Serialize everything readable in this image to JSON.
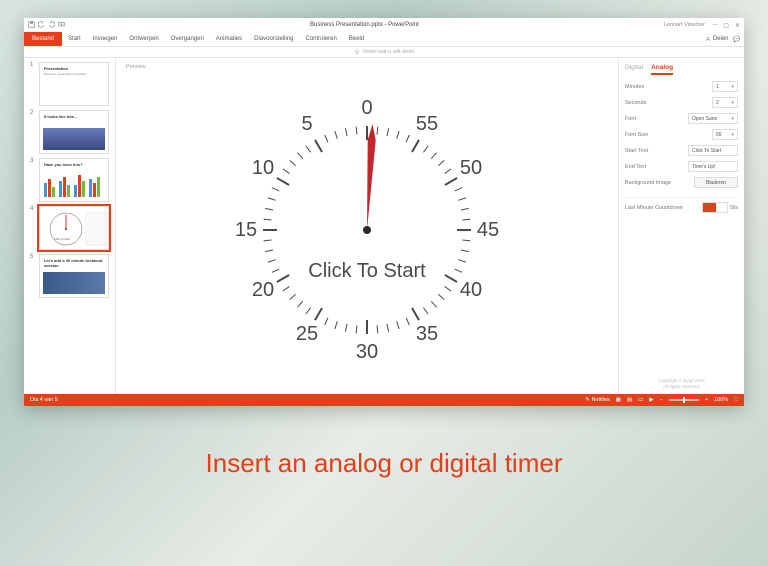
{
  "window": {
    "title": "Business Presentation.pptx - PowerPoint",
    "user": "Lennart Visscher"
  },
  "ribbon": {
    "file": "Bestand",
    "tabs": [
      "Start",
      "Invoegen",
      "Ontwerpen",
      "Overgangen",
      "Animaties",
      "Diavoorstelling",
      "Controleren",
      "Beeld"
    ],
    "search": "Vertel wat u wilt doen",
    "share": "Delen"
  },
  "thumbs": [
    {
      "num": "1",
      "title": "Presentation",
      "sub": "Business presentation template"
    },
    {
      "num": "2",
      "title": "It looks like this..."
    },
    {
      "num": "3",
      "title": "Have you seen this?"
    },
    {
      "num": "4",
      "title": "Click To Start"
    },
    {
      "num": "5",
      "title": "Let's add a 30 minute breakout session"
    }
  ],
  "preview": {
    "label": "Preview",
    "centerText": "Click To Start",
    "numbers": {
      "n0": "0",
      "n5": "5",
      "n10": "10",
      "n15": "15",
      "n20": "20",
      "n25": "25",
      "n30": "30",
      "n35": "35",
      "n40": "40",
      "n45": "45",
      "n50": "50",
      "n55": "55"
    }
  },
  "panel": {
    "tabDigital": "Digital",
    "tabAnalog": "Analog",
    "minutesLabel": "Minutes",
    "minutesVal": "1",
    "secondsLabel": "Seconds",
    "secondsVal": "2",
    "fontLabel": "Font",
    "fontVal": "Open Sans",
    "fontSizeLabel": "Font Size",
    "fontSizeVal": "56",
    "startTextLabel": "Start Text",
    "startTextVal": "Click To Start",
    "endTextLabel": "End Text",
    "endTextVal": "Time's Up!",
    "bgImageLabel": "Background Image",
    "browse": "Bladeren",
    "lastMinLabel": "Last Minute Countdown",
    "toggleVal": "56s",
    "copyright1": "Copyright © Bygit 2016",
    "copyright2": "All rights reserved."
  },
  "status": {
    "left": "Dia 4 van 5",
    "notes": "Notities",
    "zoom": "100%"
  },
  "caption": "Insert an analog or digital timer"
}
